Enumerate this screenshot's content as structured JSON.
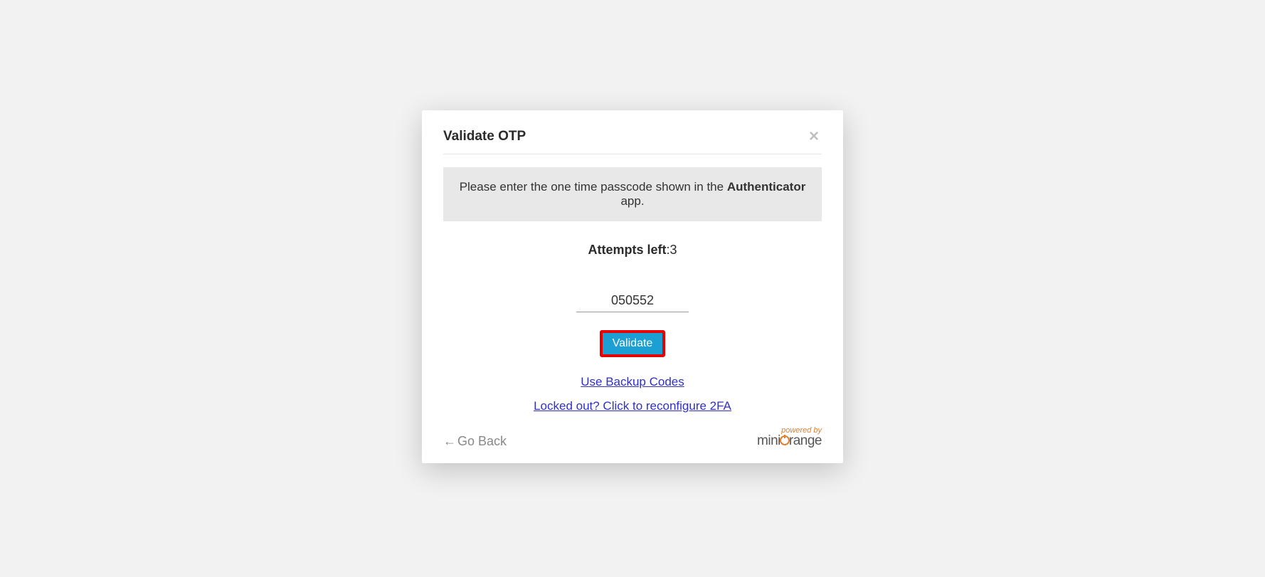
{
  "modal": {
    "title": "Validate OTP",
    "close_label": "×",
    "info_prefix": "Please enter the one time passcode shown in the ",
    "info_bold": "Authenticator",
    "info_suffix": " app.",
    "attempts_label": "Attempts left",
    "attempts_separator": ":",
    "attempts_value": "3",
    "otp_value": "050552",
    "validate_label": "Validate",
    "backup_codes_link": "Use Backup Codes",
    "locked_out_link": "Locked out? Click to reconfigure 2FA",
    "go_back_label": "Go Back"
  },
  "footer": {
    "powered_by": "powered by",
    "brand_part1": "mini",
    "brand_part2": "range"
  }
}
